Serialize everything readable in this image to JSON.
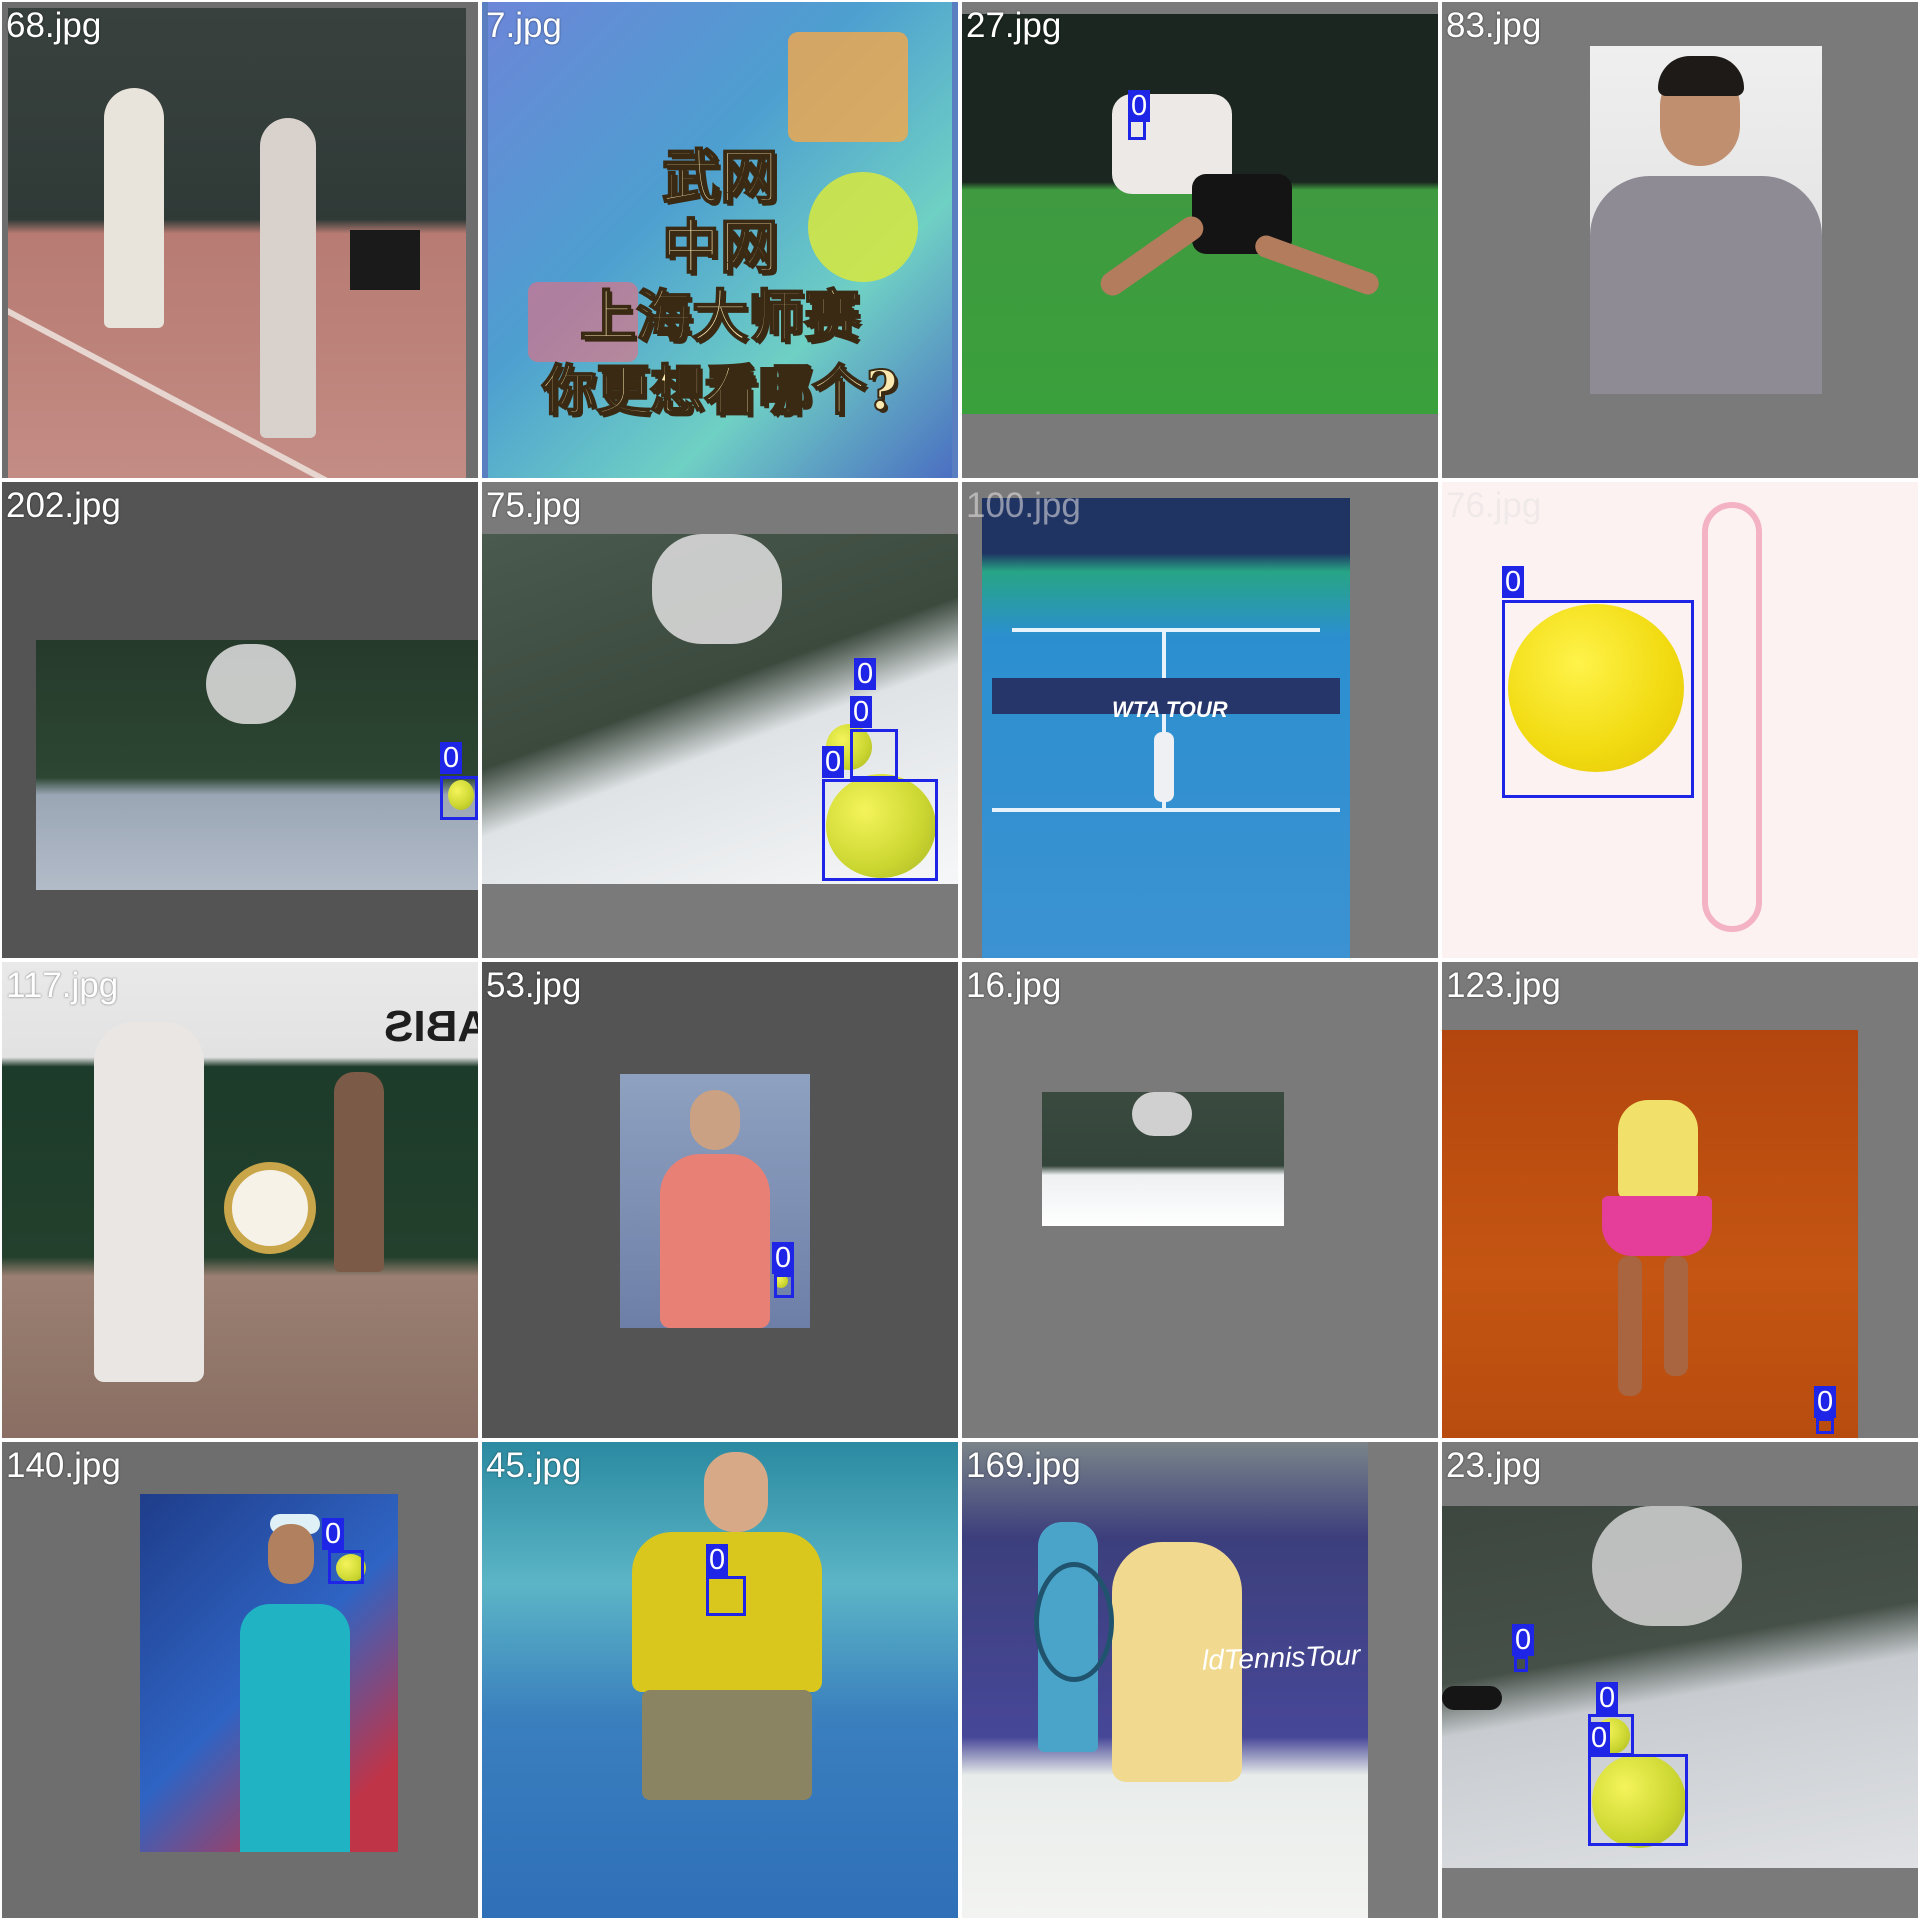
{
  "colors": {
    "box": "#1f25e6",
    "pad_dark": "#545454",
    "pad_mid": "#7a7a7a",
    "label_text": "#ffffff"
  },
  "class_label": "0",
  "tiles": [
    {
      "filename": "68.jpg"
    },
    {
      "filename": "7.jpg",
      "overlay_text": [
        "武网",
        "中网",
        "上海大师赛",
        "你更想看哪个?"
      ]
    },
    {
      "filename": "27.jpg"
    },
    {
      "filename": "83.jpg"
    },
    {
      "filename": "202.jpg"
    },
    {
      "filename": "75.jpg"
    },
    {
      "filename": "100.jpg",
      "banner_text": "WTA TOUR"
    },
    {
      "filename": "76.jpg"
    },
    {
      "filename": "117.jpg",
      "banner_text": "ABIS"
    },
    {
      "filename": "53.jpg"
    },
    {
      "filename": "16.jpg"
    },
    {
      "filename": "123.jpg"
    },
    {
      "filename": "140.jpg"
    },
    {
      "filename": "45.jpg"
    },
    {
      "filename": "169.jpg",
      "banner_text": "ldTennisTour"
    },
    {
      "filename": "23.jpg"
    }
  ]
}
